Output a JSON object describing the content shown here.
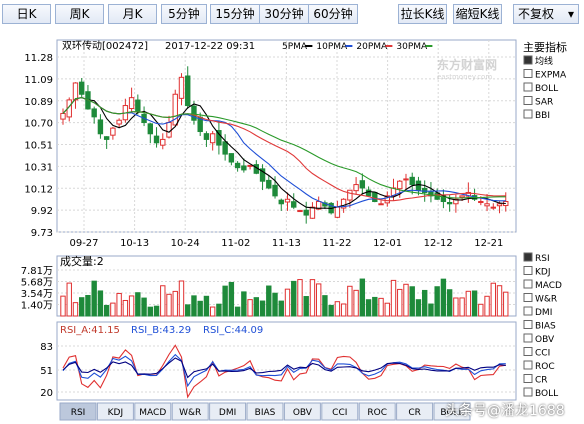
{
  "toolbar": {
    "periods": [
      "日K",
      "周K",
      "月K",
      "5分钟",
      "15分钟",
      "30分钟",
      "60分钟"
    ],
    "active_period": "日K",
    "stretch_label": "拉长K线",
    "shrink_label": "缩短K线",
    "adjust_label": "不复权"
  },
  "main": {
    "title": "双环传动[002472]",
    "datetime": "2017-12-22 09:31",
    "ma_items": [
      {
        "label": "5PMA",
        "color": "#000000"
      },
      {
        "label": "10PMA",
        "color": "#1f4fd6"
      },
      {
        "label": "20PMA",
        "color": "#e03a3a"
      },
      {
        "label": "30PMA",
        "color": "#2a9a2a"
      }
    ],
    "watermark_logo": "东方财富网",
    "watermark_url": "eastmoney.com",
    "y_ticks": [
      "11.28",
      "11.09",
      "10.89",
      "10.70",
      "10.51",
      "10.31",
      "10.12",
      "9.92",
      "9.73"
    ],
    "x_ticks": [
      "09-27",
      "10-13",
      "10-24",
      "11-02",
      "11-13",
      "11-22",
      "12-01",
      "12-12",
      "12-21"
    ]
  },
  "volume": {
    "title": "成交量:2",
    "y_ticks": [
      "7.81万",
      "5.68万",
      "3.54万",
      "1.40万"
    ]
  },
  "rsi": {
    "rsi_a": "RSI_A:41.15",
    "rsi_b": "RSI_B:43.29",
    "rsi_c": "RSI_C:44.09",
    "y_ticks": [
      "83",
      "51",
      "20"
    ]
  },
  "right_panel": {
    "heading": "主要指标",
    "main_items": [
      {
        "label": "均线",
        "checked": true
      },
      {
        "label": "EXPMA",
        "checked": false
      },
      {
        "label": "BOLL",
        "checked": false
      },
      {
        "label": "SAR",
        "checked": false
      },
      {
        "label": "BBI",
        "checked": false
      }
    ],
    "sub_items": [
      {
        "label": "RSI",
        "checked": true
      },
      {
        "label": "KDJ",
        "checked": false
      },
      {
        "label": "MACD",
        "checked": false
      },
      {
        "label": "W&R",
        "checked": false
      },
      {
        "label": "DMI",
        "checked": false
      },
      {
        "label": "BIAS",
        "checked": false
      },
      {
        "label": "OBV",
        "checked": false
      },
      {
        "label": "CCI",
        "checked": false
      },
      {
        "label": "ROC",
        "checked": false
      },
      {
        "label": "CR",
        "checked": false
      },
      {
        "label": "BOLL",
        "checked": false
      }
    ]
  },
  "bottom_tabs": [
    "RSI",
    "KDJ",
    "MACD",
    "W&R",
    "DMI",
    "BIAS",
    "OBV",
    "CCI",
    "ROC",
    "CR",
    "BOLL"
  ],
  "active_bottom_tab": "RSI",
  "footer_watermark": "头条号@潘龙1688",
  "colors": {
    "up": "#e03030",
    "down": "#1e8a3a",
    "grid": "#d8d8d8",
    "frame": "#9aaac8"
  }
}
